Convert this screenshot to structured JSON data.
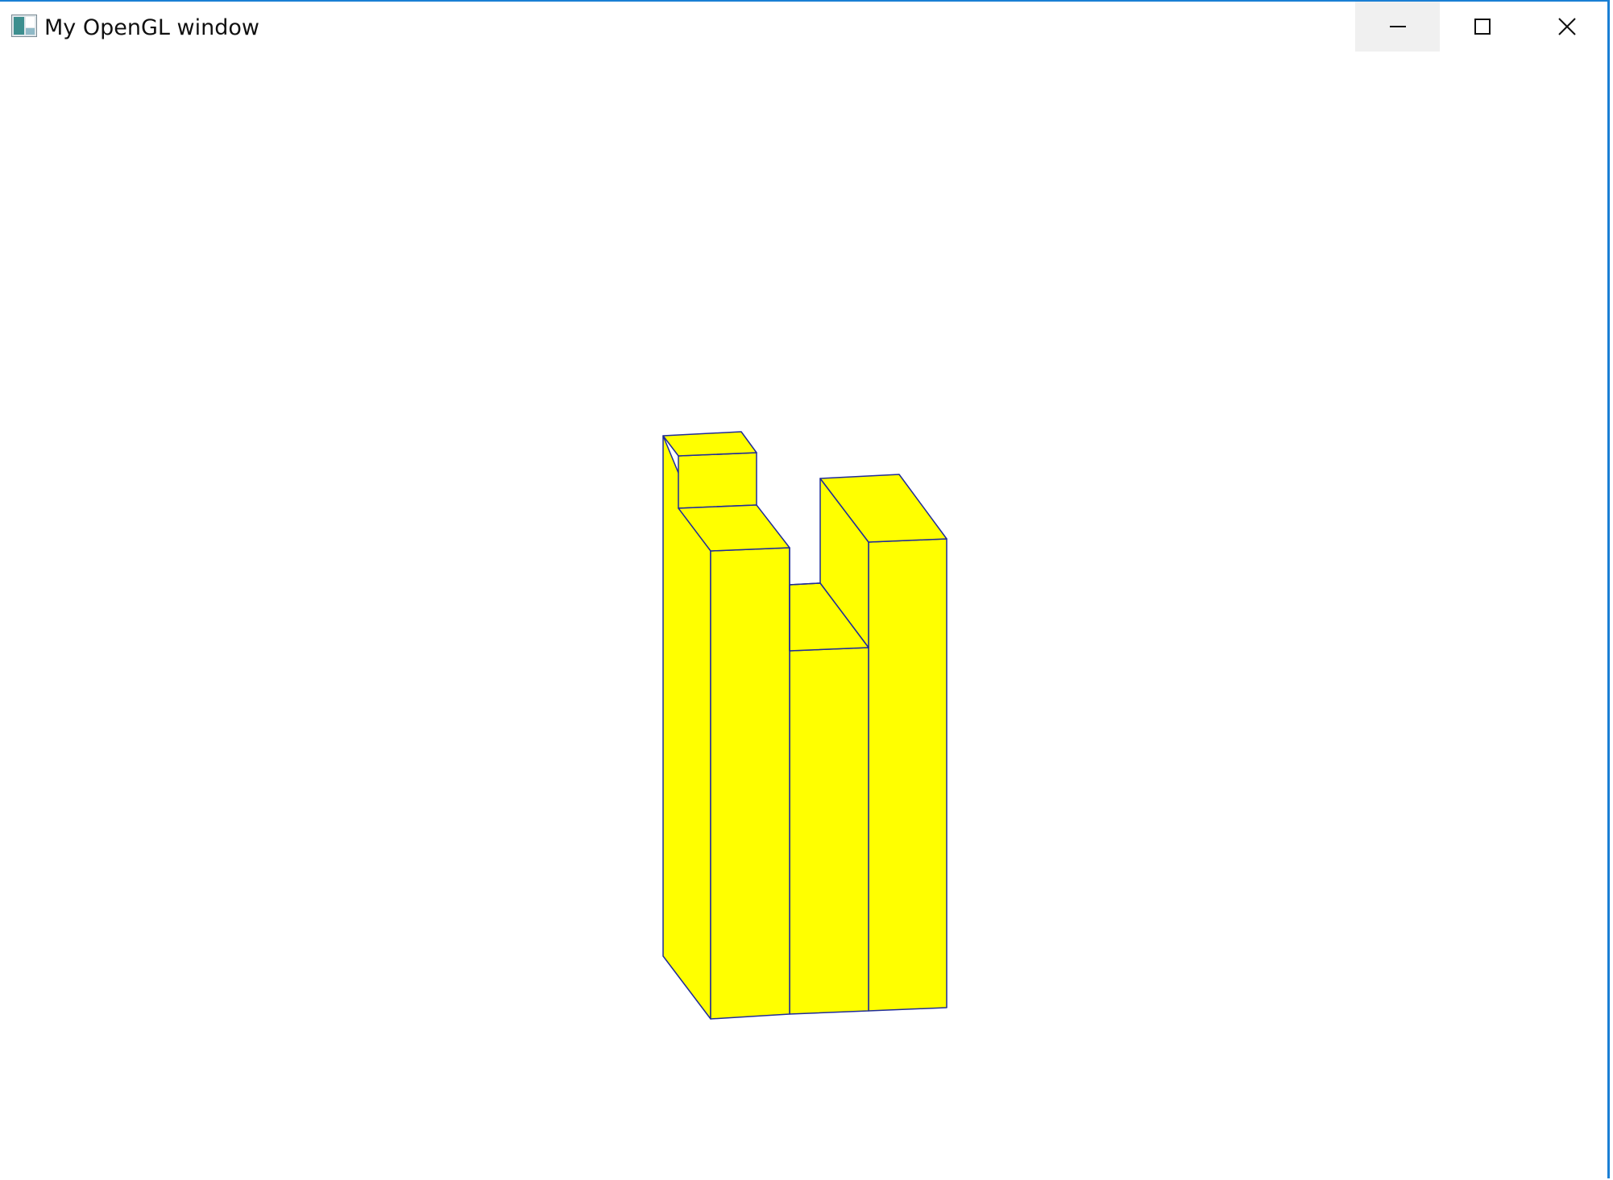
{
  "window": {
    "title": "My OpenGL window",
    "icon": "opengl-window-icon",
    "controls": {
      "minimize_icon": "minimize-icon",
      "maximize_icon": "maximize-icon",
      "close_icon": "close-icon"
    }
  },
  "viewport": {
    "background": "#ffffff",
    "object": {
      "fill_color": "#ffff00",
      "edge_color": "#1f2b9a"
    }
  },
  "colors": {
    "accent_border": "#1a7fd4",
    "minimize_hover_bg": "#f0f0f0"
  }
}
